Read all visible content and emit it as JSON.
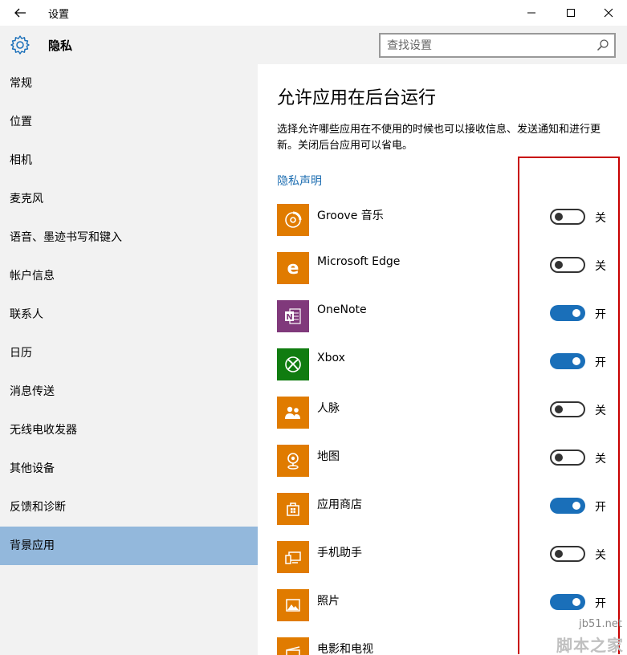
{
  "window": {
    "title": "设置"
  },
  "header": {
    "page_title": "隐私",
    "search_placeholder": "查找设置"
  },
  "sidebar": {
    "items": [
      {
        "label": "常规",
        "selected": false
      },
      {
        "label": "位置",
        "selected": false
      },
      {
        "label": "相机",
        "selected": false
      },
      {
        "label": "麦克风",
        "selected": false
      },
      {
        "label": "语音、墨迹书写和键入",
        "selected": false
      },
      {
        "label": "帐户信息",
        "selected": false
      },
      {
        "label": "联系人",
        "selected": false
      },
      {
        "label": "日历",
        "selected": false
      },
      {
        "label": "消息传送",
        "selected": false
      },
      {
        "label": "无线电收发器",
        "selected": false
      },
      {
        "label": "其他设备",
        "selected": false
      },
      {
        "label": "反馈和诊断",
        "selected": false
      },
      {
        "label": "背景应用",
        "selected": true
      }
    ]
  },
  "main": {
    "heading": "允许应用在后台运行",
    "description": "选择允许哪些应用在不使用的时候也可以接收信息、发送通知和进行更新。关闭后台应用可以省电。",
    "privacy_link": "隐私声明",
    "apps": [
      {
        "name": "Groove 音乐",
        "icon": "groove-music-icon",
        "icon_bg": "#e07b00",
        "on": false,
        "state_label": "关"
      },
      {
        "name": "Microsoft Edge",
        "icon": "edge-icon",
        "icon_bg": "#e07b00",
        "on": false,
        "state_label": "关"
      },
      {
        "name": "OneNote",
        "icon": "onenote-icon",
        "icon_bg": "#80397b",
        "on": true,
        "state_label": "开"
      },
      {
        "name": "Xbox",
        "icon": "xbox-icon",
        "icon_bg": "#107c10",
        "on": true,
        "state_label": "开"
      },
      {
        "name": "人脉",
        "icon": "people-icon",
        "icon_bg": "#e07b00",
        "on": false,
        "state_label": "关"
      },
      {
        "name": "地图",
        "icon": "maps-icon",
        "icon_bg": "#e07b00",
        "on": false,
        "state_label": "关"
      },
      {
        "name": "应用商店",
        "icon": "store-icon",
        "icon_bg": "#e07b00",
        "on": true,
        "state_label": "开"
      },
      {
        "name": "手机助手",
        "icon": "phone-companion-icon",
        "icon_bg": "#e07b00",
        "on": false,
        "state_label": "关"
      },
      {
        "name": "照片",
        "icon": "photos-icon",
        "icon_bg": "#e07b00",
        "on": true,
        "state_label": "开"
      },
      {
        "name": "电影和电视",
        "icon": "movies-tv-icon",
        "icon_bg": "#e07b00",
        "on": null,
        "state_label": ""
      }
    ]
  },
  "watermark": {
    "url": "jb51.net",
    "text": "脚本之家"
  },
  "colors": {
    "accent": "#1a6fb9",
    "selected_nav": "#93b8dc",
    "app_tile": "#e07b00",
    "highlight": "#c80000"
  }
}
